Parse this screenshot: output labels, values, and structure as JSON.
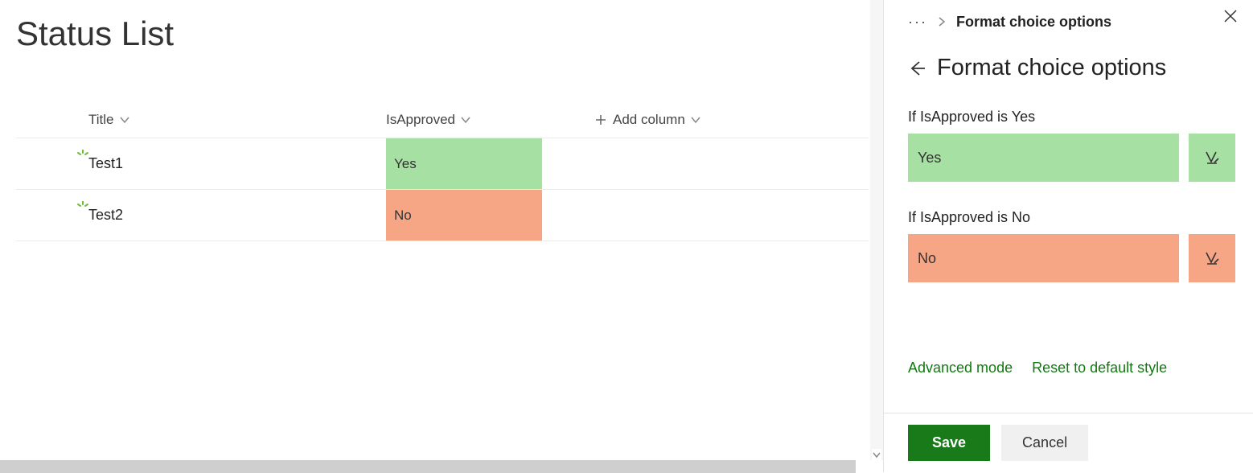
{
  "page": {
    "title": "Status List"
  },
  "columns": {
    "title": "Title",
    "isApproved": "IsApproved",
    "addColumn": "Add column"
  },
  "rows": [
    {
      "title": "Test1",
      "isApproved": "Yes",
      "approvedClass": "approved-yes"
    },
    {
      "title": "Test2",
      "isApproved": "No",
      "approvedClass": "approved-no"
    }
  ],
  "panel": {
    "breadcrumbCurrent": "Format choice options",
    "title": "Format choice options",
    "rules": {
      "yes": {
        "label": "If IsApproved is Yes",
        "value": "Yes"
      },
      "no": {
        "label": "If IsApproved is No",
        "value": "No"
      }
    },
    "links": {
      "advanced": "Advanced mode",
      "reset": "Reset to default style"
    },
    "buttons": {
      "save": "Save",
      "cancel": "Cancel"
    }
  }
}
